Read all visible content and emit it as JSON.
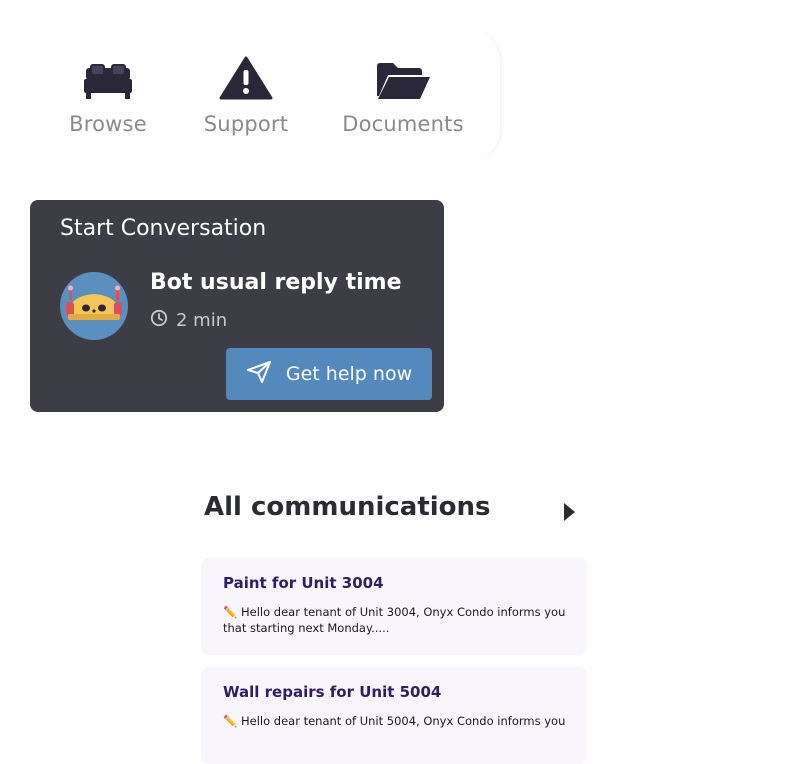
{
  "quick_actions": {
    "browse_label": "Browse",
    "support_label": "Support",
    "documents_label": "Documents",
    "icons": {
      "browse": "bed-icon",
      "support": "warning-icon",
      "documents": "folder-open-icon"
    }
  },
  "conversation": {
    "title": "Start Conversation",
    "avatar_icon": "bot-avatar-icon",
    "reply_title": "Bot usual reply time",
    "reply_time": "2 min",
    "help_button_label": "Get help now"
  },
  "communications": {
    "title": "All communications",
    "items": [
      {
        "title": "Paint for Unit 3004",
        "body": "✏️ Hello dear tenant of Unit 3004, Onyx Condo informs you that starting next Monday....."
      },
      {
        "title": "Wall repairs for Unit 5004",
        "body": "✏️ Hello dear tenant of Unit 5004, Onyx Condo informs you"
      }
    ]
  },
  "colors": {
    "card_bg": "#3d3d45",
    "accent_button": "#5389bd",
    "comm_title": "#2e1f5e",
    "comm_card_bg": "#f8f6fc"
  }
}
